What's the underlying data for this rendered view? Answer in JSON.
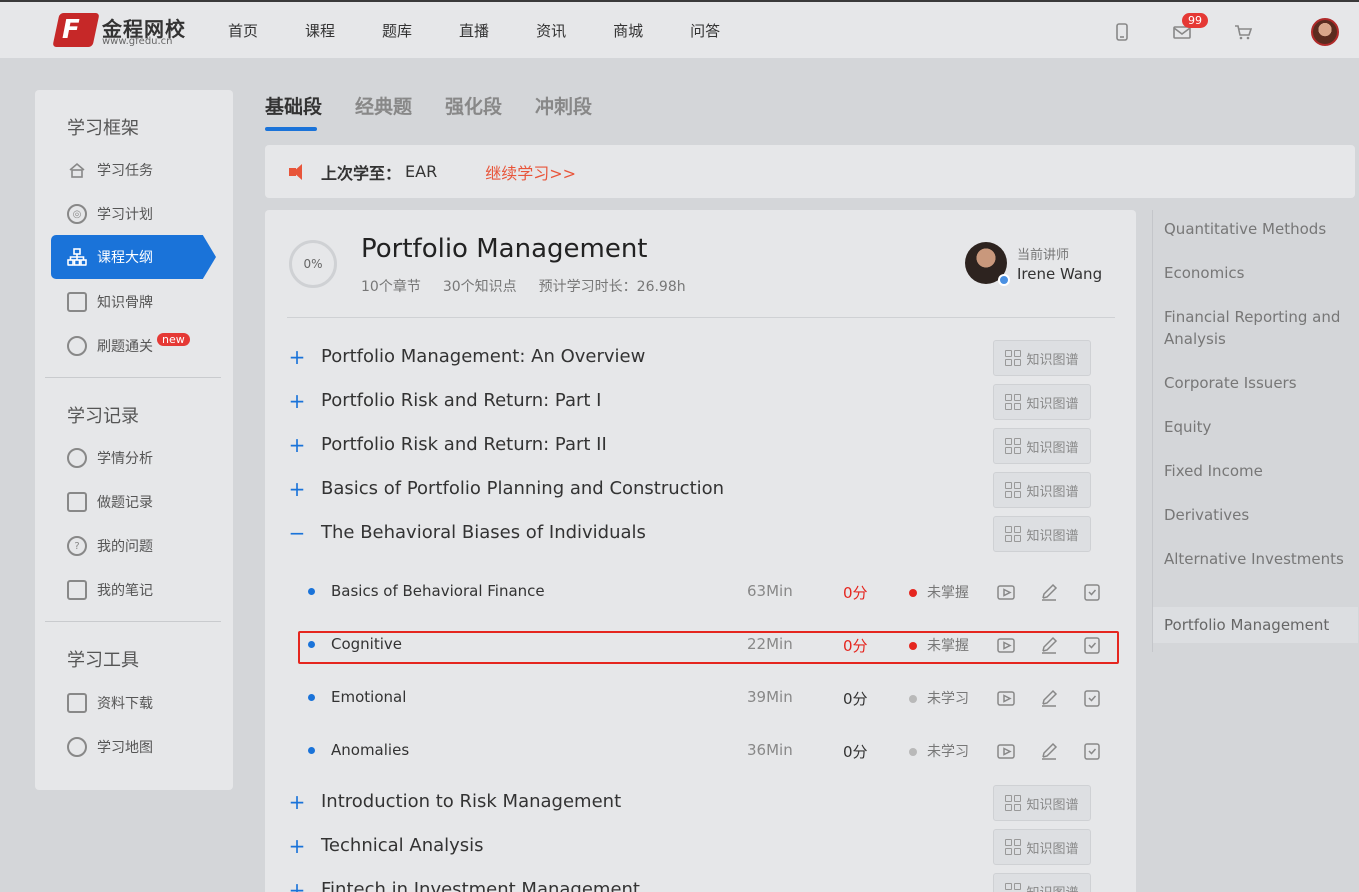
{
  "brand": {
    "name": "金程网校",
    "url": "www.gfedu.cn"
  },
  "nav": [
    "首页",
    "课程",
    "题库",
    "直播",
    "资讯",
    "商城",
    "问答"
  ],
  "notifications": {
    "count": "99"
  },
  "icons": {
    "phone": "phone-icon",
    "mail": "mail-icon",
    "cart": "cart-icon"
  },
  "sidebar": {
    "sections": [
      {
        "heading": "学习框架",
        "items": [
          "学习任务",
          "学习计划",
          "课程大纲",
          "知识骨牌",
          "刷题通关"
        ]
      },
      {
        "heading": "学习记录",
        "items": [
          "学情分析",
          "做题记录",
          "我的问题",
          "我的笔记"
        ]
      },
      {
        "heading": "学习工具",
        "items": [
          "资料下载",
          "学习地图"
        ]
      }
    ],
    "active_item": "课程大纲",
    "new_badge": "new"
  },
  "stage_tabs": [
    "基础段",
    "经典题",
    "强化段",
    "冲刺段"
  ],
  "last_study": {
    "label": "上次学至：",
    "value": "EAR",
    "continue": "继续学习>>"
  },
  "course": {
    "progress": "0%",
    "title": "Portfolio Management",
    "chapters_count": "10个章节",
    "points_count": "30个知识点",
    "est_time": "预计学习时长：26.98h",
    "teacher_label": "当前讲师",
    "teacher_name": "Irene Wang"
  },
  "kmap_label": "知识图谱",
  "chapters": [
    {
      "title": "Portfolio Management: An Overview",
      "toggle": "+"
    },
    {
      "title": "Portfolio Risk and Return: Part I",
      "toggle": "+"
    },
    {
      "title": "Portfolio Risk and Return: Part II",
      "toggle": "+"
    },
    {
      "title": "Basics of Portfolio Planning and Construction",
      "toggle": "+"
    },
    {
      "title": "The Behavioral Biases of Individuals",
      "toggle": "−"
    },
    {
      "title": "Introduction to Risk Management",
      "toggle": "+"
    },
    {
      "title": "Technical Analysis",
      "toggle": "+"
    },
    {
      "title": "Fintech in Investment Management",
      "toggle": "+"
    }
  ],
  "lessons": [
    {
      "title": "Basics of Behavioral Finance",
      "duration": "63Min",
      "score": "0分",
      "status": "未掌握",
      "score_color": "#e5261f",
      "status_color": "#e5261f"
    },
    {
      "title": "Cognitive",
      "duration": "22Min",
      "score": "0分",
      "status": "未掌握",
      "score_color": "#e5261f",
      "status_color": "#e5261f"
    },
    {
      "title": "Emotional",
      "duration": "39Min",
      "score": "0分",
      "status": "未学习",
      "score_color": "#333333",
      "status_color": "#b9b9b9"
    },
    {
      "title": "Anomalies",
      "duration": "36Min",
      "score": "0分",
      "status": "未学习",
      "score_color": "#333333",
      "status_color": "#b9b9b9"
    }
  ],
  "subjects": [
    "Quantitative Methods",
    "Economics",
    "Financial Reporting and Analysis",
    "Corporate Issuers",
    "Equity",
    "Fixed Income",
    "Derivatives",
    "Alternative Investments",
    "Portfolio Management"
  ],
  "active_subject": "Portfolio Management",
  "colors": {
    "accent": "#1a73d9",
    "alert": "#e5261f",
    "link": "#e8553a"
  }
}
